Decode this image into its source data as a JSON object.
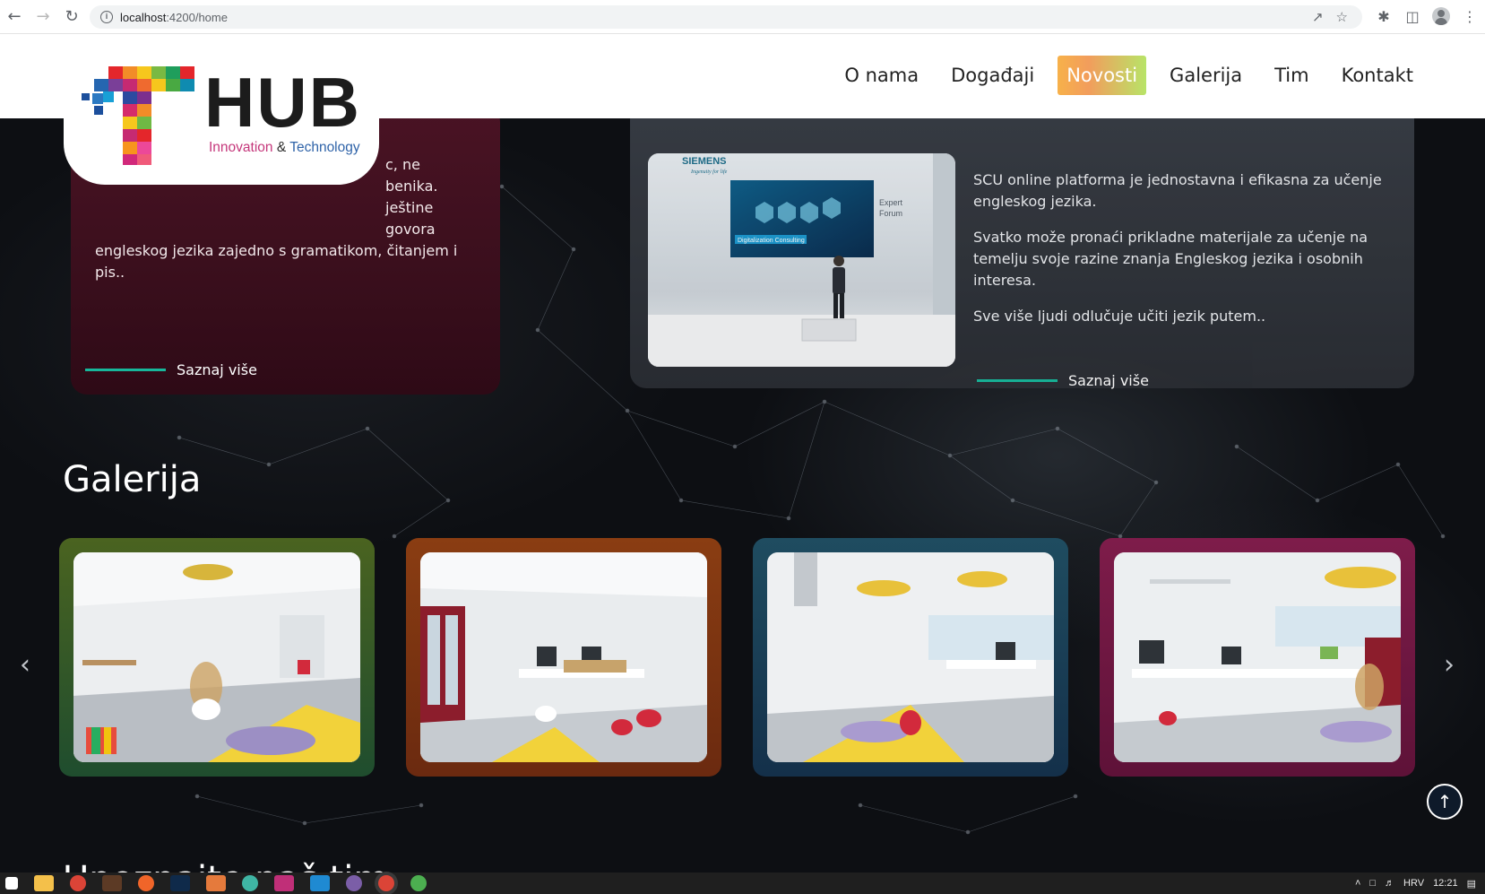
{
  "browser": {
    "url_host": "localhost",
    "url_path": ":4200/home"
  },
  "header": {
    "logo_word": "HUB",
    "logo_tagline_a": "Innovation",
    "logo_tagline_b": " & ",
    "logo_tagline_c": "Technology",
    "nav": [
      {
        "label": "O nama",
        "active": false
      },
      {
        "label": "Događaji",
        "active": false
      },
      {
        "label": "Novosti",
        "active": true
      },
      {
        "label": "Galerija",
        "active": false
      },
      {
        "label": "Tim",
        "active": false
      },
      {
        "label": "Kontakt",
        "active": false
      }
    ]
  },
  "news": {
    "left": {
      "text_visible": "c, ne",
      "text_line2": "benika.",
      "text_line3": "ještine govora",
      "text_line4": "engleskog jezika zajedno s gramatikom, čitanjem i",
      "text_line5": "pis..",
      "read_more": "Saznaj više"
    },
    "right": {
      "paragraphs": [
        "SCU online platforma je jednostavna i efikasna za učenje engleskog jezika.",
        "Svatko može pronaći prikladne materijale za učenje na temelju svoje razine znanja Engleskog jezika i osobnih interesa.",
        "Sve više ljudi odlučuje učiti jezik putem.."
      ],
      "read_more": "Saznaj više",
      "photo": {
        "brand": "SIEMENS",
        "sub": "Ingenuity for life",
        "screen_label": "Digitalization Consulting",
        "side_label_1": "Expert",
        "side_label_2": "Forum"
      }
    }
  },
  "gallery": {
    "title": "Galerija",
    "cards": [
      {
        "frame_color": "#3f5d1f"
      },
      {
        "frame_color": "#8a3a12"
      },
      {
        "frame_color": "#1d4658"
      },
      {
        "frame_color": "#7a1a46"
      }
    ]
  },
  "next_section_title": "Upoznajte naš tim",
  "taskbar": {
    "lang": "HRV",
    "time": "12:21"
  },
  "colors": {
    "accent_line": "#17b79b",
    "active_nav_from": "#f7b14a",
    "active_nav_to": "#b8e468"
  }
}
